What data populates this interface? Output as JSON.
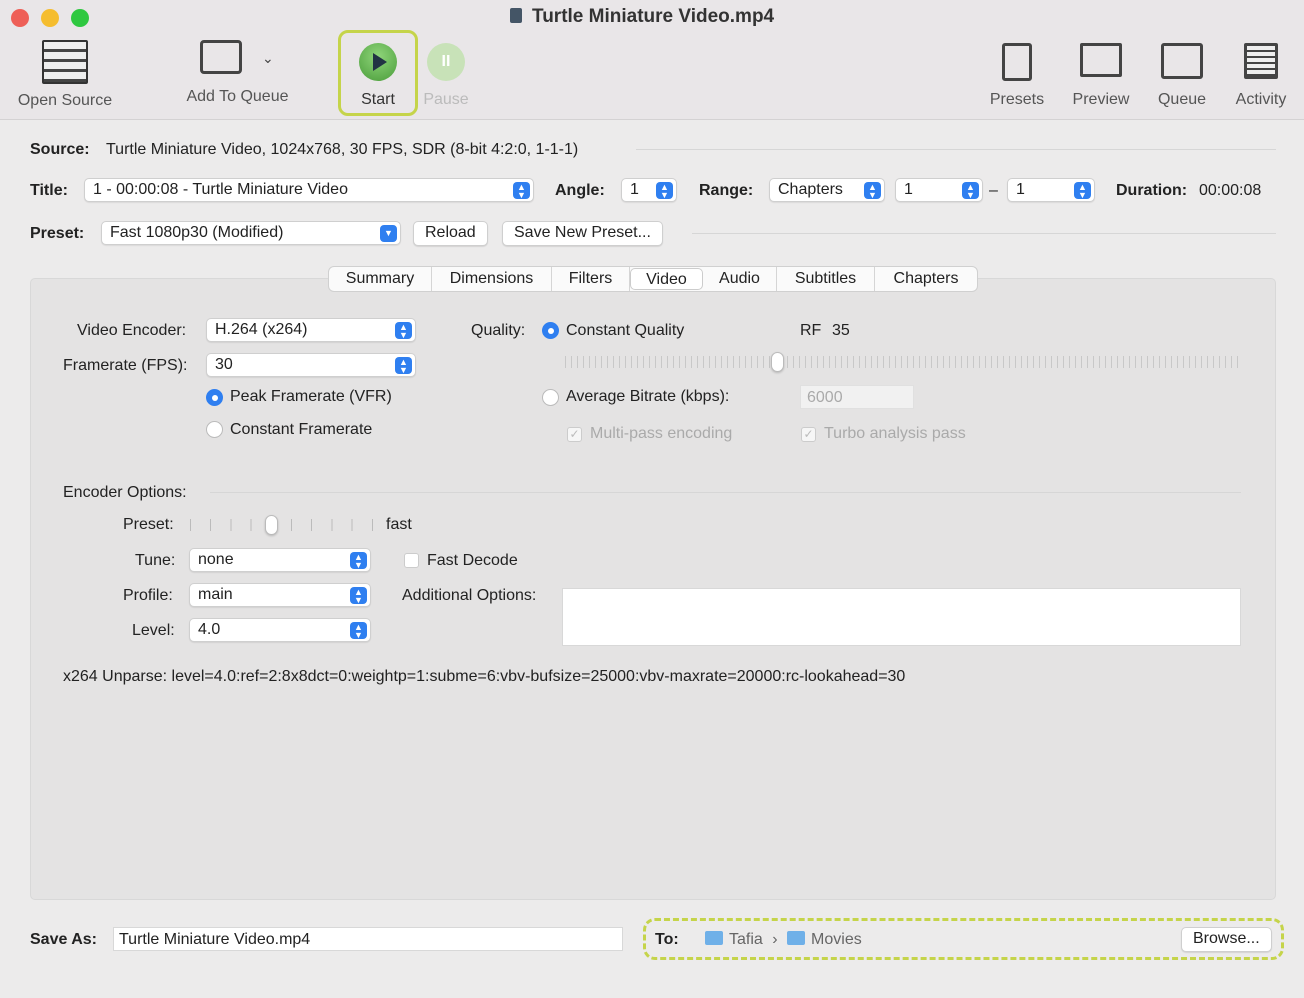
{
  "window": {
    "title": "Turtle Miniature Video.mp4"
  },
  "toolbar": {
    "open_source": "Open Source",
    "add_to_queue": "Add To Queue",
    "start": "Start",
    "pause": "Pause",
    "presets": "Presets",
    "preview": "Preview",
    "queue": "Queue",
    "activity": "Activity"
  },
  "source": {
    "label": "Source:",
    "value": "Turtle Miniature Video, 1024x768, 30 FPS, SDR (8-bit 4:2:0, 1-1-1)"
  },
  "title_row": {
    "label": "Title:",
    "value": "1 - 00:00:08 - Turtle Miniature Video",
    "angle_label": "Angle:",
    "angle": "1",
    "range_label": "Range:",
    "range": "Chapters",
    "range_start": "1",
    "range_sep": "–",
    "range_end": "1",
    "duration_label": "Duration:",
    "duration": "00:00:08"
  },
  "preset": {
    "label": "Preset:",
    "value": "Fast 1080p30 (Modified)",
    "reload": "Reload",
    "save_new": "Save New Preset..."
  },
  "tabs": [
    {
      "label": "Summary"
    },
    {
      "label": "Dimensions"
    },
    {
      "label": "Filters"
    },
    {
      "label": "Video",
      "active": true
    },
    {
      "label": "Audio"
    },
    {
      "label": "Subtitles"
    },
    {
      "label": "Chapters"
    }
  ],
  "video": {
    "encoder_label": "Video Encoder:",
    "encoder": "H.264 (x264)",
    "framerate_label": "Framerate (FPS):",
    "framerate": "30",
    "peak": "Peak Framerate (VFR)",
    "constant": "Constant Framerate",
    "framerate_mode": "Peak Framerate (VFR)",
    "quality_label": "Quality:",
    "constant_quality": "Constant Quality",
    "rf_label": "RF",
    "rf": "35",
    "rf_value": 35,
    "rf_range": [
      0,
      51
    ],
    "avg_bitrate": "Average Bitrate (kbps):",
    "bitrate": "6000",
    "multipass": "Multi-pass encoding",
    "turbo": "Turbo analysis pass",
    "encoder_options": "Encoder Options:",
    "preset_label": "Preset:",
    "preset_value": "fast",
    "tune_label": "Tune:",
    "tune": "none",
    "fast_decode": "Fast Decode",
    "profile_label": "Profile:",
    "profile": "main",
    "additional_label": "Additional Options:",
    "additional": "",
    "level_label": "Level:",
    "level": "4.0",
    "unparse": "x264 Unparse: level=4.0:ref=2:8x8dct=0:weightp=1:subme=6:vbv-bufsize=25000:vbv-maxrate=20000:rc-lookahead=30"
  },
  "save": {
    "label": "Save As:",
    "value": "Turtle Miniature Video.mp4",
    "to_label": "To:",
    "path": [
      "Tafia",
      "Movies"
    ],
    "path_sep": "›",
    "browse": "Browse..."
  },
  "colors": {
    "accent": "#2f7ff0",
    "highlight": "#c5d44a",
    "start_green": "#5fb24a"
  }
}
